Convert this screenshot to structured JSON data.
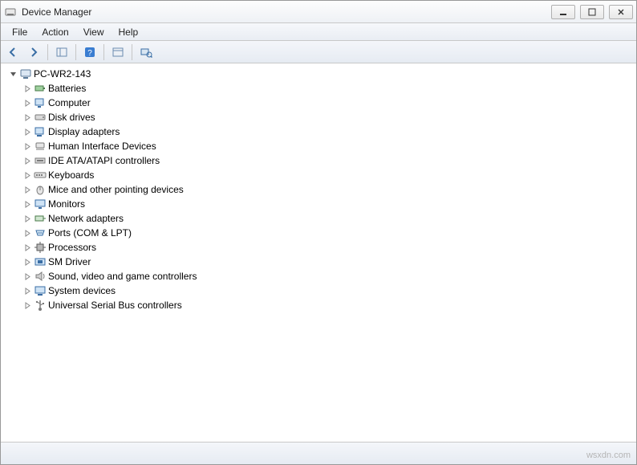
{
  "window": {
    "title": "Device Manager"
  },
  "menu": {
    "file": "File",
    "action": "Action",
    "view": "View",
    "help": "Help"
  },
  "tree": {
    "root": "PC-WR2-143",
    "items": [
      "Batteries",
      "Computer",
      "Disk drives",
      "Display adapters",
      "Human Interface Devices",
      "IDE ATA/ATAPI controllers",
      "Keyboards",
      "Mice and other pointing devices",
      "Monitors",
      "Network adapters",
      "Ports (COM & LPT)",
      "Processors",
      "SM Driver",
      "Sound, video and game controllers",
      "System devices",
      "Universal Serial Bus controllers"
    ]
  },
  "watermark": "wsxdn.com"
}
